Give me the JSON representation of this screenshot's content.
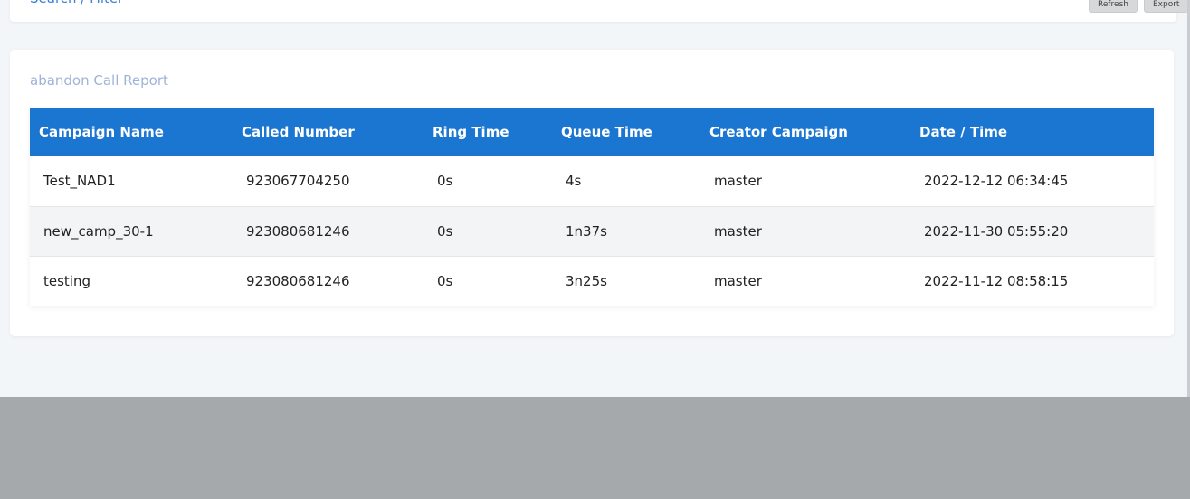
{
  "filter": {
    "title": "Search / Filter",
    "refresh_label": "Refresh",
    "export_label": "Export"
  },
  "report": {
    "title": "abandon Call Report",
    "columns": [
      "Campaign Name",
      "Called Number",
      "Ring Time",
      "Queue Time",
      "Creator Campaign",
      "Date / Time"
    ],
    "rows": [
      [
        "Test_NAD1",
        "923067704250",
        "0s",
        "4s",
        "master",
        "2022-12-12 06:34:45"
      ],
      [
        "new_camp_30-1",
        "923080681246",
        "0s",
        "1n37s",
        "master",
        "2022-11-30 05:55:20"
      ],
      [
        "testing",
        "923080681246",
        "0s",
        "3n25s",
        "master",
        "2022-11-12 08:58:15"
      ]
    ]
  },
  "colors": {
    "header_bg": "#1b76d2",
    "link": "#3d7fd6",
    "report_title": "#9fb3d8"
  }
}
